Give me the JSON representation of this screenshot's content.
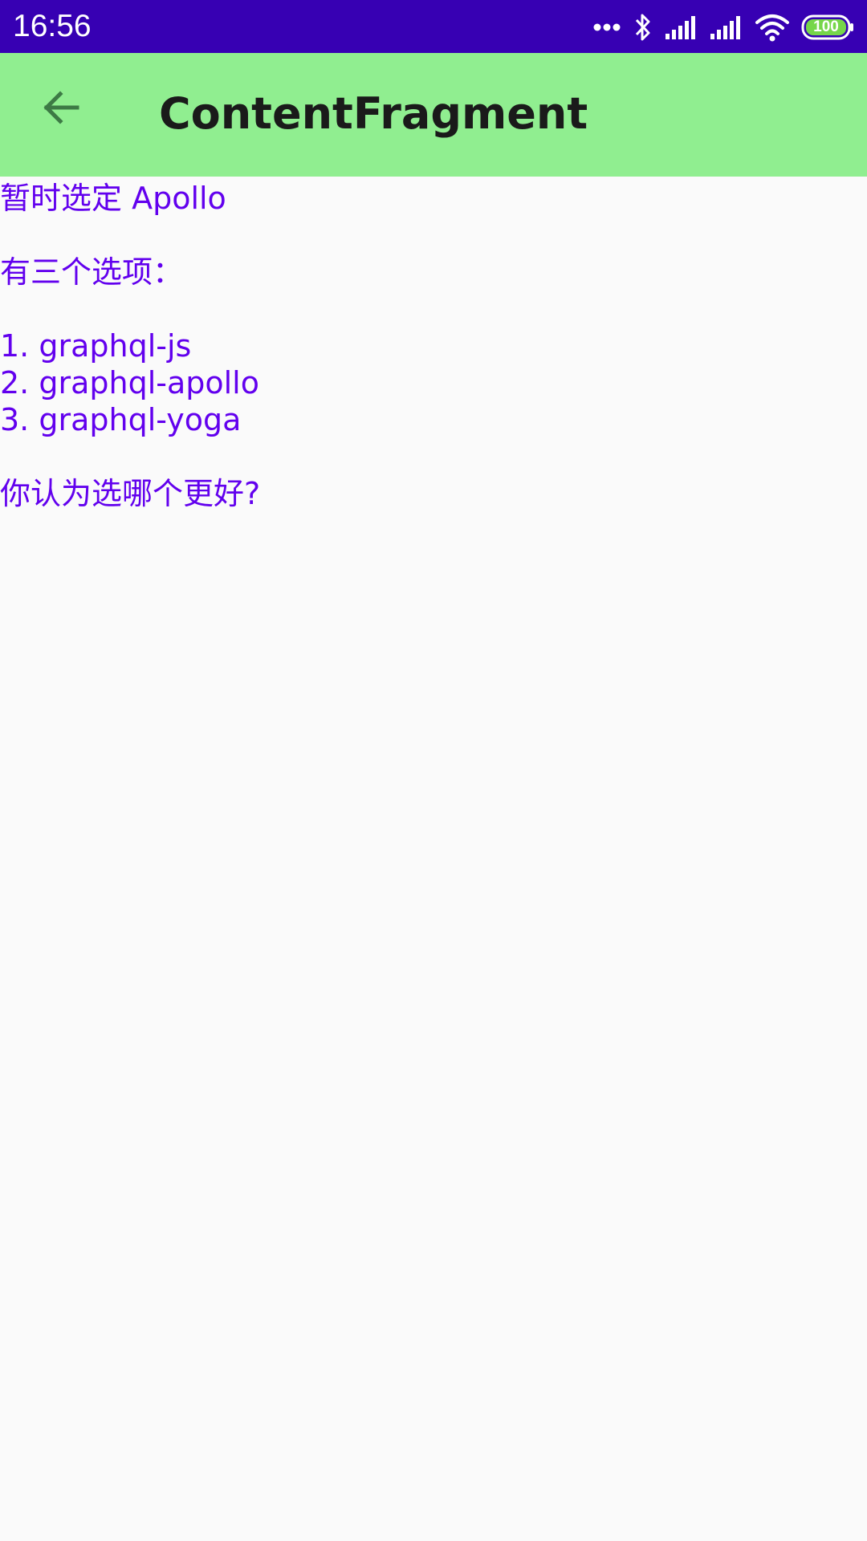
{
  "status_bar": {
    "time": "16:56",
    "battery_level": "100",
    "icons": [
      "more-dots-icon",
      "bluetooth-icon",
      "signal-icon",
      "signal-icon",
      "wifi-icon",
      "battery-icon"
    ],
    "background_color": "#3700b3"
  },
  "app_bar": {
    "title": "ContentFragment",
    "back_icon": "arrow-back-icon",
    "background_color": "#90ee90"
  },
  "content": {
    "text_color": "#6200ee",
    "lines": [
      "暂时选定 Apollo",
      "",
      "有三个选项：",
      "",
      "1. graphql-js",
      "2. graphql-apollo",
      "3. graphql-yoga",
      "",
      "你认为选哪个更好?"
    ]
  }
}
